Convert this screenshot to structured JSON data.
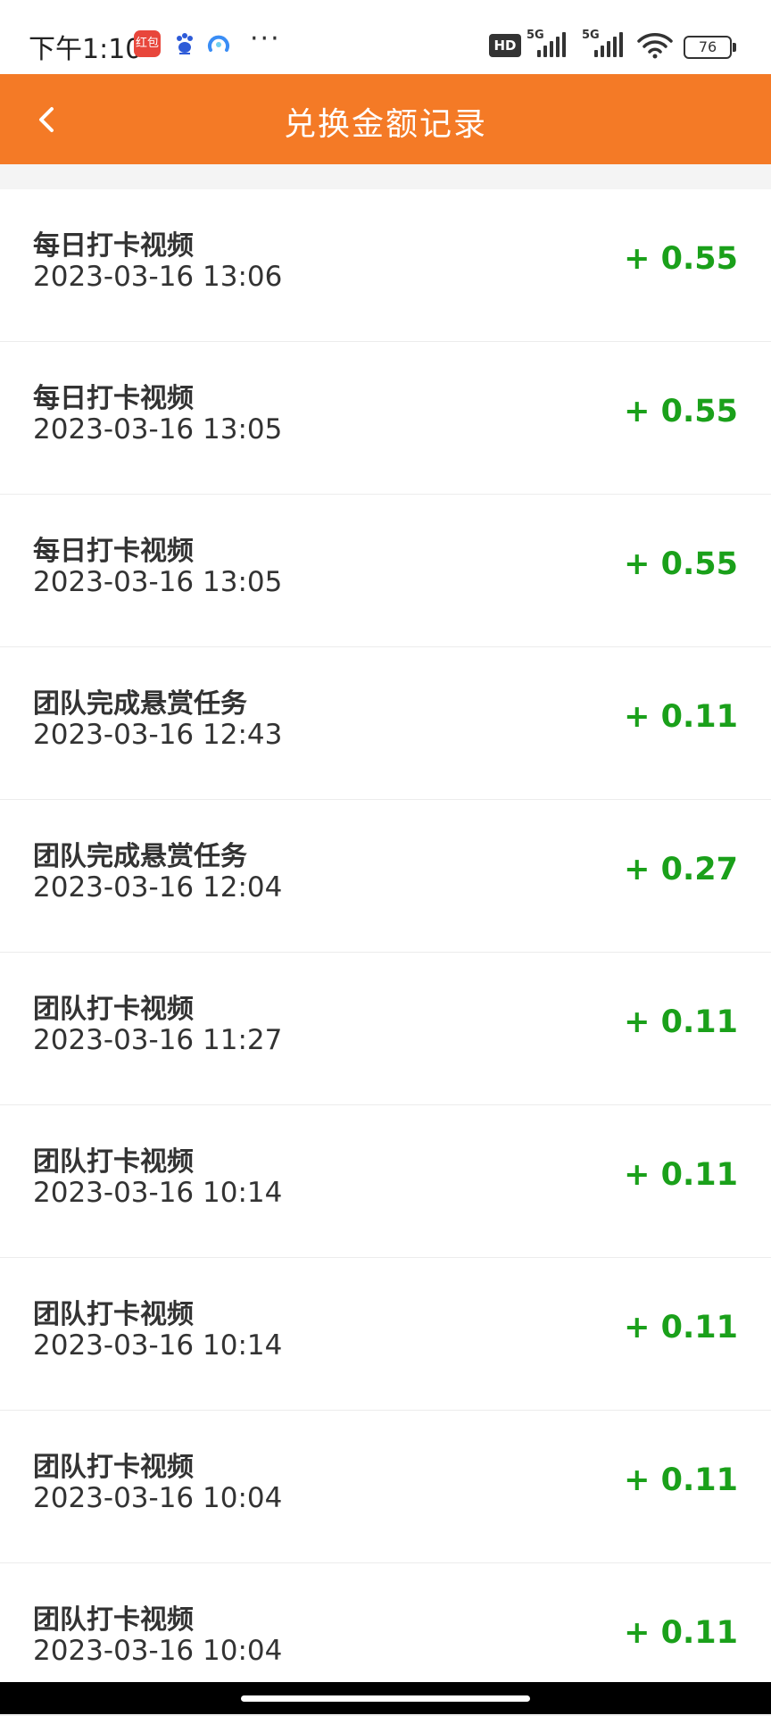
{
  "status_bar": {
    "time": "下午1:10",
    "app_icon_1": "红包",
    "more": "···",
    "hd": "HD",
    "network_1": "5G",
    "network_2": "5G",
    "battery": "76"
  },
  "header": {
    "title": "兑换金额记录",
    "back_icon": "chevron-left-icon"
  },
  "colors": {
    "header_bg": "#f47a26",
    "amount": "#1aa01a"
  },
  "records": [
    {
      "title": "每日打卡视频",
      "time": "2023-03-16 13:06",
      "amount": "+ 0.55"
    },
    {
      "title": "每日打卡视频",
      "time": "2023-03-16 13:05",
      "amount": "+ 0.55"
    },
    {
      "title": "每日打卡视频",
      "time": "2023-03-16 13:05",
      "amount": "+ 0.55"
    },
    {
      "title": "团队完成悬赏任务",
      "time": "2023-03-16 12:43",
      "amount": "+ 0.11"
    },
    {
      "title": "团队完成悬赏任务",
      "time": "2023-03-16 12:04",
      "amount": "+ 0.27"
    },
    {
      "title": "团队打卡视频",
      "time": "2023-03-16 11:27",
      "amount": "+ 0.11"
    },
    {
      "title": "团队打卡视频",
      "time": "2023-03-16 10:14",
      "amount": "+ 0.11"
    },
    {
      "title": "团队打卡视频",
      "time": "2023-03-16 10:14",
      "amount": "+ 0.11"
    },
    {
      "title": "团队打卡视频",
      "time": "2023-03-16 10:04",
      "amount": "+ 0.11"
    },
    {
      "title": "团队打卡视频",
      "time": "2023-03-16 10:04",
      "amount": "+ 0.11"
    }
  ]
}
